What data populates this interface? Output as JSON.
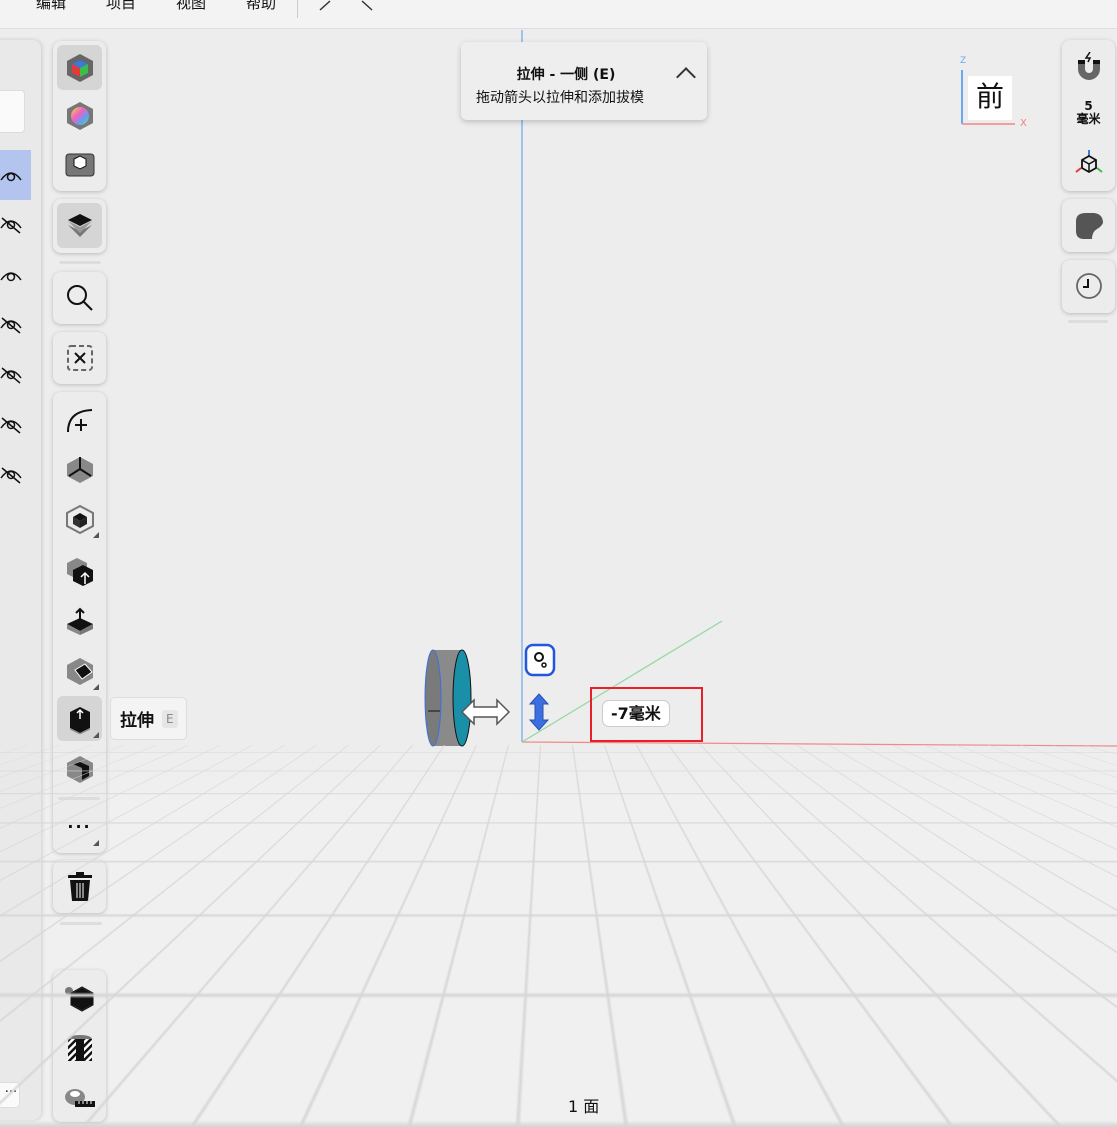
{
  "menubar": {
    "items": [
      "编辑",
      "项目",
      "视图",
      "帮助"
    ]
  },
  "hint": {
    "title": "拉伸 - 一侧 (E)",
    "subtitle": "拖动箭头以拉伸和添加拔模"
  },
  "tooltip": {
    "label": "拉伸",
    "shortcut": "E"
  },
  "right_toolbar": {
    "snap_value": "5",
    "snap_unit": "毫米"
  },
  "viewcube": {
    "face": "前",
    "axis_z": "Z",
    "axis_x": "X"
  },
  "dimension": {
    "value": "-7毫米"
  },
  "status": {
    "text": "1 面"
  },
  "left_panel": {
    "more_label": "···",
    "rows": [
      {
        "visible": true,
        "selected": true
      },
      {
        "visible": false
      },
      {
        "visible": true
      },
      {
        "visible": false
      },
      {
        "visible": false
      },
      {
        "visible": false
      },
      {
        "visible": false
      }
    ]
  },
  "toolbar": {
    "more_label": "···"
  },
  "colors": {
    "accent": "#3b6fe0",
    "selection": "#b3c5ee",
    "x_axis": "#f08080",
    "y_axis": "#80d090",
    "z_axis": "#5aa0f0",
    "face": "#1a8fa8",
    "highlight": "#e8202a"
  }
}
